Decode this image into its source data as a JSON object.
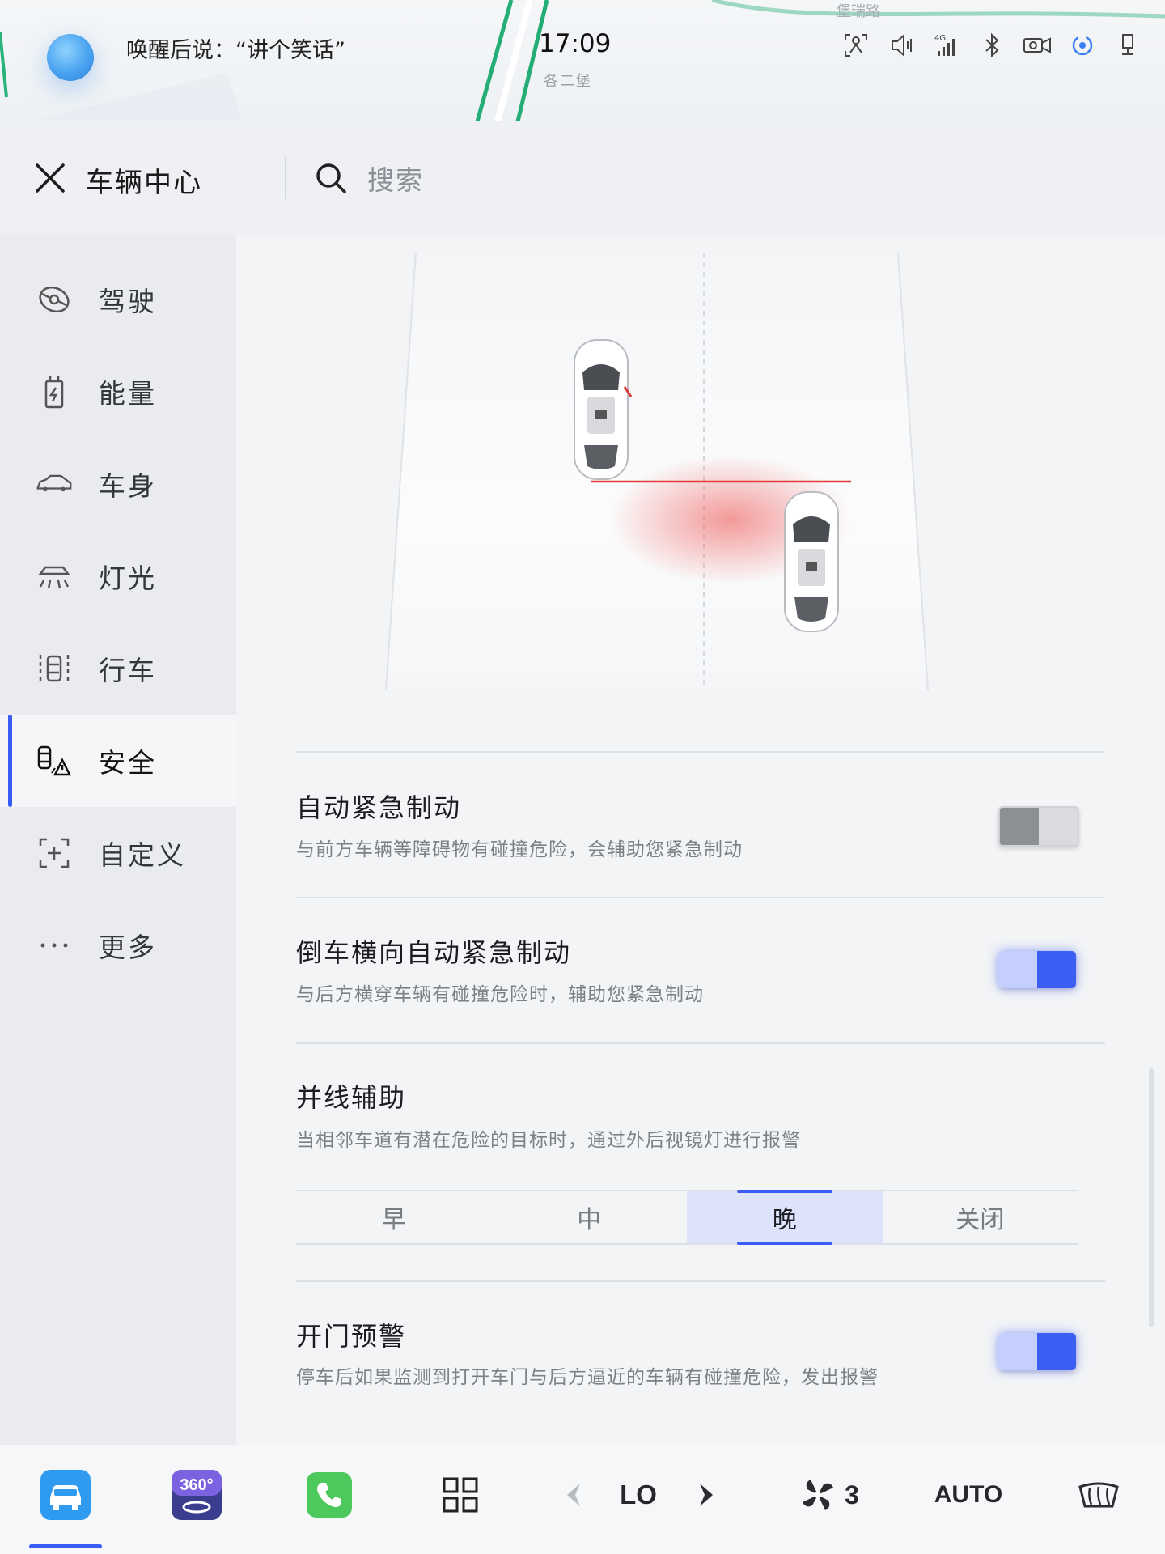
{
  "status_bar": {
    "voice_hint": "唤醒后说：“讲个笑话”",
    "time": "17:09",
    "road_name": "各二堡",
    "map_road_label": "堡瑞路",
    "icons": [
      "driver-monitor-icon",
      "volume-icon",
      "signal-4g-icon",
      "bluetooth-icon",
      "dashcam-icon",
      "hotspot-icon",
      "usb-icon"
    ],
    "signal_label": "4G"
  },
  "header": {
    "title": "车辆中心",
    "search_placeholder": "搜索"
  },
  "sidebar": {
    "items": [
      {
        "label": "驾驶",
        "icon": "steering-wheel-icon"
      },
      {
        "label": "能量",
        "icon": "battery-charge-icon"
      },
      {
        "label": "车身",
        "icon": "car-body-icon"
      },
      {
        "label": "灯光",
        "icon": "headlight-icon"
      },
      {
        "label": "行车",
        "icon": "lane-icon"
      },
      {
        "label": "安全",
        "icon": "car-warning-icon"
      },
      {
        "label": "自定义",
        "icon": "custom-add-icon"
      },
      {
        "label": "更多",
        "icon": "more-dots-icon"
      }
    ],
    "active_index": 5
  },
  "settings": {
    "aeb": {
      "title": "自动紧急制动",
      "desc": "与前方车辆等障碍物有碰撞危险，会辅助您紧急制动",
      "enabled": false
    },
    "rcta": {
      "title": "倒车横向自动紧急制动",
      "desc": "与后方横穿车辆有碰撞危险时，辅助您紧急制动",
      "enabled": true
    },
    "lane_assist": {
      "title": "并线辅助",
      "desc": "当相邻车道有潜在危险的目标时，通过外后视镜灯进行报警",
      "options": [
        "早",
        "中",
        "晚",
        "关闭"
      ],
      "selected": "晚"
    },
    "door_warning": {
      "title": "开门预警",
      "desc": "停车后如果监测到打开车门与后方逼近的车辆有碰撞危险，发出报警",
      "enabled": true
    }
  },
  "dock": {
    "items": [
      {
        "name": "vehicle-center-icon"
      },
      {
        "name": "camera-360-icon",
        "label": "360°"
      },
      {
        "name": "phone-icon"
      },
      {
        "name": "apps-grid-icon"
      },
      {
        "name": "temp-decrease-icon"
      },
      {
        "name": "temperature-value",
        "label": "LO"
      },
      {
        "name": "temp-increase-icon"
      },
      {
        "name": "fan-icon",
        "label": "3"
      },
      {
        "name": "climate-auto",
        "label": "AUTO"
      },
      {
        "name": "rear-defrost-icon"
      }
    ]
  },
  "colors": {
    "accent": "#3a5cf5",
    "toggle_on": "#3c5ef2",
    "toggle_off": "#8c8f94",
    "warning_red": "#e23b3b"
  }
}
